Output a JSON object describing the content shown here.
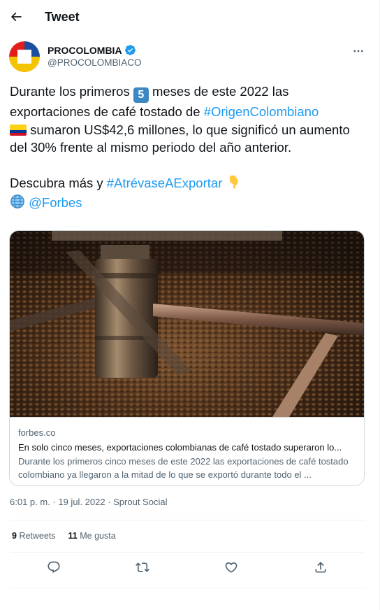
{
  "header": {
    "title": "Tweet",
    "back_icon": "arrow-left-icon"
  },
  "author": {
    "name": "PROCOLOMBIA",
    "handle": "@PROCOLOMBIACO",
    "verified_icon": "verified-badge-icon",
    "avatar_colors": [
      "#e31d1a",
      "#1a4fa0",
      "#f5c400",
      "#ffffff"
    ]
  },
  "tweet": {
    "line1_pre": "Durante los primeros ",
    "keycap_digit": "5",
    "line1_post": " meses de este 2022 las exportaciones de café tostado de ",
    "hashtag1": "#OrigenColombiano",
    "line2_post": " sumaron US$42,6 millones, lo que significó un aumento del 30% frente al mismo periodo del año anterior.",
    "line3_pre": "Descubra más y ",
    "hashtag2": "#AtrévaseAExportar",
    "mention": "@Forbes",
    "emoji": {
      "flag": "colombia-flag",
      "hand": "backhand-index-pointing-down",
      "globe": "globe-with-meridians"
    }
  },
  "card": {
    "domain": "forbes.co",
    "title": "En solo cinco meses, exportaciones colombianas de café tostado superaron lo...",
    "description": "Durante los primeros cinco meses de este 2022 las exportaciones de café tostado colombiano ya llegaron a la mitad de lo que se exportó durante todo el ..."
  },
  "meta": {
    "timestamp": "6:01 p. m. · 19 jul. 2022 · Sprout Social"
  },
  "stats": {
    "retweets_count": "9",
    "retweets_label": "Retweets",
    "likes_count": "11",
    "likes_label": "Me gusta"
  },
  "actions": [
    "reply-icon",
    "retweet-icon",
    "like-icon",
    "share-icon"
  ],
  "colors": {
    "link": "#1d9bf0",
    "text": "#0f1419",
    "muted": "#536471",
    "border": "#cfd9de"
  }
}
